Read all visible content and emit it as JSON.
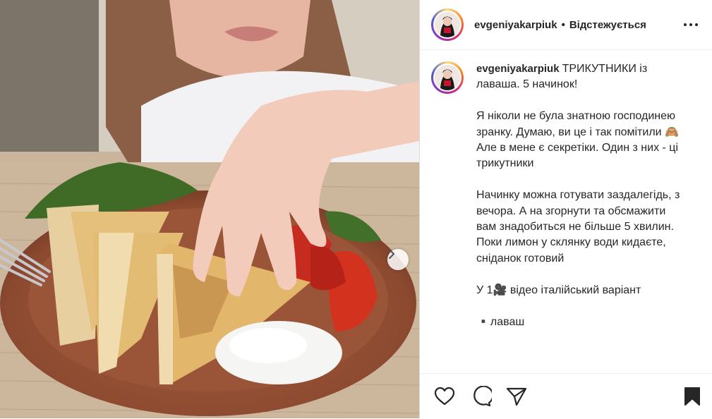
{
  "post": {
    "username": "evgeniyakarpiuk",
    "separator": "•",
    "follow_status": "Відстежується",
    "caption_username": "evgeniyakarpiuk",
    "caption_text": "ТРИКУТНИКИ із лаваша. 5 начинок!\n\nЯ ніколи не була знатною господинею зранку. Думаю, ви це і так помітили 🙈 Але в мене є секретіки. Один з них - ці трикутники\n\nНачинку можна готувати заздалегідь, з вечора. А на згорнути та обсмажити вам знадобиться не більше 5 хвилин. Поки лимон у склянку води кидаєте, сніданок готовий\n\nУ 1🎥 відео італійський варіант\n\n▪️лаваш"
  },
  "icons": {
    "more": "more-options-icon",
    "next": "chevron-right-icon",
    "like": "heart-icon",
    "comment": "comment-icon",
    "share": "paper-plane-icon",
    "save": "bookmark-icon"
  },
  "colors": {
    "ring_start": "#feda75",
    "ring_mid": "#d62976",
    "ring_end": "#4f5bd5",
    "text": "#262626",
    "border": "#dbdbdb"
  }
}
